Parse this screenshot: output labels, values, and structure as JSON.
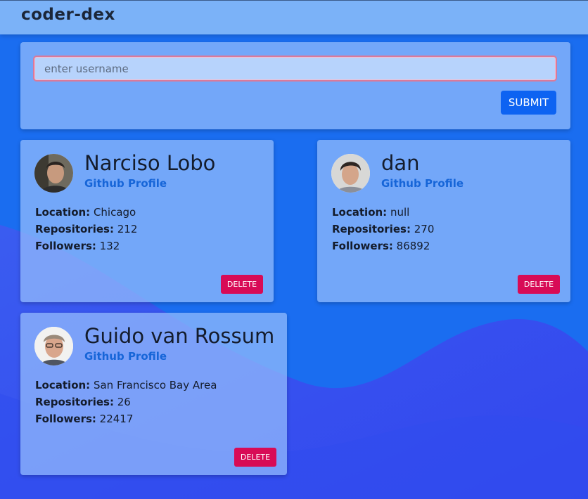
{
  "app": {
    "title": "coder-dex"
  },
  "search": {
    "placeholder": "enter username",
    "value": "",
    "submit_label": "SUBMIT"
  },
  "users": [
    {
      "name": "Narciso Lobo",
      "link_label": "Github Profile",
      "location_label": "Location:",
      "location": "Chicago",
      "repos_label": "Repositories:",
      "repos": "212",
      "followers_label": "Followers:",
      "followers": "132",
      "delete_label": "DELETE"
    },
    {
      "name": "dan",
      "link_label": "Github Profile",
      "location_label": "Location:",
      "location": "null",
      "repos_label": "Repositories:",
      "repos": "270",
      "followers_label": "Followers:",
      "followers": "86892",
      "delete_label": "DELETE"
    },
    {
      "name": "Guido van Rossum",
      "link_label": "Github Profile",
      "location_label": "Location:",
      "location": "San Francisco Bay Area",
      "repos_label": "Repositories:",
      "repos": "26",
      "followers_label": "Followers:",
      "followers": "22417",
      "delete_label": "DELETE"
    }
  ],
  "colors": {
    "header": "#7bb2f8",
    "background": "#1f66ef",
    "accent": "#0d63f2",
    "delete": "#d80b56",
    "link": "#1665d8"
  }
}
